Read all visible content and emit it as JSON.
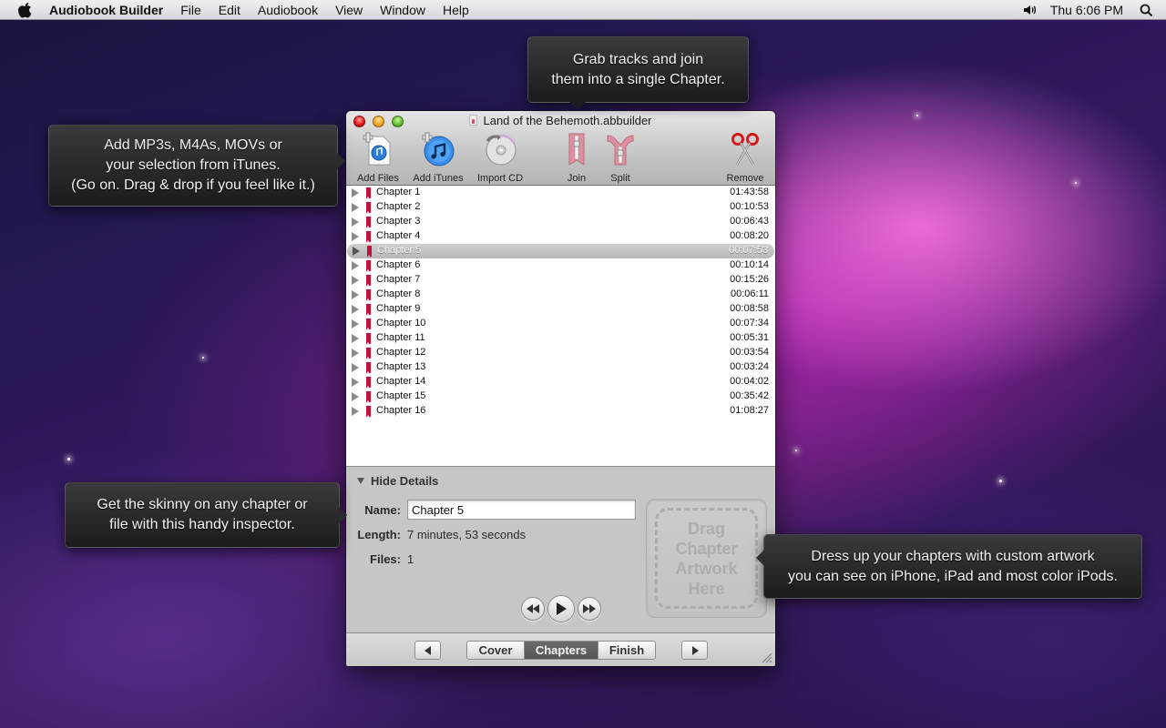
{
  "menubar": {
    "app_name": "Audiobook Builder",
    "menus": [
      "File",
      "Edit",
      "Audiobook",
      "View",
      "Window",
      "Help"
    ],
    "clock": "Thu 6:06 PM",
    "icons": [
      "apple-icon",
      "volume-icon",
      "spotlight-search-icon"
    ]
  },
  "window": {
    "title": "Land of the Behemoth.abbuilder",
    "toolbar": {
      "add_files": "Add Files",
      "add_itunes": "Add iTunes",
      "import_cd": "Import CD",
      "join": "Join",
      "split": "Split",
      "remove": "Remove"
    },
    "chapters": [
      {
        "name": "Chapter 1",
        "duration": "01:43:58"
      },
      {
        "name": "Chapter 2",
        "duration": "00:10:53"
      },
      {
        "name": "Chapter 3",
        "duration": "00:06:43"
      },
      {
        "name": "Chapter 4",
        "duration": "00:08:20"
      },
      {
        "name": "Chapter 5",
        "duration": "00:07:53",
        "selected": true
      },
      {
        "name": "Chapter 6",
        "duration": "00:10:14"
      },
      {
        "name": "Chapter 7",
        "duration": "00:15:26"
      },
      {
        "name": "Chapter 8",
        "duration": "00:06:11"
      },
      {
        "name": "Chapter 9",
        "duration": "00:08:58"
      },
      {
        "name": "Chapter 10",
        "duration": "00:07:34"
      },
      {
        "name": "Chapter 11",
        "duration": "00:05:31"
      },
      {
        "name": "Chapter 12",
        "duration": "00:03:54"
      },
      {
        "name": "Chapter 13",
        "duration": "00:03:24"
      },
      {
        "name": "Chapter 14",
        "duration": "00:04:02"
      },
      {
        "name": "Chapter 15",
        "duration": "00:35:42"
      },
      {
        "name": "Chapter 16",
        "duration": "01:08:27"
      }
    ],
    "details": {
      "toggle_label": "Hide Details",
      "name_label": "Name:",
      "name_value": "Chapter 5",
      "length_label": "Length:",
      "length_value": "7 minutes, 53 seconds",
      "files_label": "Files:",
      "files_value": "1",
      "artwork_placeholder": "Drag Chapter Artwork Here"
    },
    "bottom": {
      "segments": [
        "Cover",
        "Chapters",
        "Finish"
      ],
      "active_segment": "Chapters"
    }
  },
  "callouts": {
    "add": [
      "Add MP3s, M4As, MOVs or",
      "your selection from iTunes.",
      "(Go on. Drag & drop if you feel like it.)"
    ],
    "join": [
      "Grab tracks and join",
      "them into a single Chapter."
    ],
    "inspector": [
      "Get the skinny on any chapter or",
      "file with this handy inspector."
    ],
    "artwork": [
      "Dress up your chapters with custom artwork",
      "you can see on iPhone, iPad and most color iPods."
    ]
  }
}
